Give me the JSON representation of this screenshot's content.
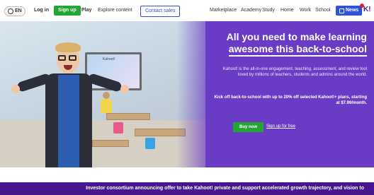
{
  "nav": {
    "language": "EN",
    "login": "Log in",
    "signup": "Sign up",
    "play": "Play",
    "explore": "Explore content",
    "contact": "Contact sales",
    "menu": [
      "Marketplace",
      "Academy",
      "Study",
      "Home",
      "Work",
      "School"
    ],
    "news": "News",
    "logo": "K!"
  },
  "hero": {
    "headline_line1": "All you need to make learning",
    "headline_line2": "awesome this back-to-school",
    "description": "Kahoot! is the all-in-one engagement, teaching, assessment, and review tool loved by millions of teachers, students and admins around the world.",
    "offer": "Kick off back-to-school with up to 20% off selected Kahoot!+ plans, starting at $7.99/month.",
    "buy_button": "Buy now",
    "signup_link": "Sign up for free",
    "screen_text": "Kahoot!"
  },
  "banner": {
    "text": "Investor consortium announcing offer to take Kahoot! private and support accelerated growth trajectory, and vision to"
  },
  "colors": {
    "brand_purple": "#46178f",
    "hero_purple": "#6a3bc4",
    "green": "#23a533",
    "blue": "#2d54d6"
  }
}
